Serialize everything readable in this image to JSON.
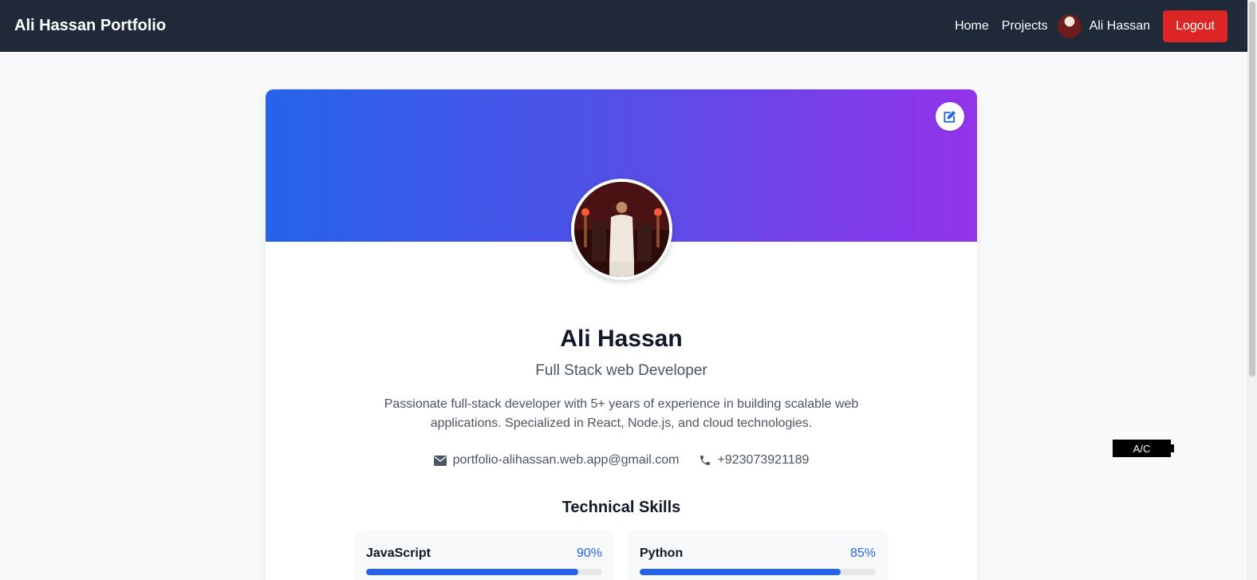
{
  "navbar": {
    "brand": "Ali Hassan Portfolio",
    "links": [
      "Home",
      "Projects"
    ],
    "user_name": "Ali Hassan",
    "logout_label": "Logout"
  },
  "profile": {
    "name": "Ali Hassan",
    "title": "Full Stack web Developer",
    "bio": "Passionate full-stack developer with 5+ years of experience in building scalable web applications. Specialized in React, Node.js, and cloud technologies.",
    "email": "portfolio-alihassan.web.app@gmail.com",
    "phone": "+923073921189",
    "banner_gradient": [
      "#2563eb",
      "#9333ea"
    ]
  },
  "skills": {
    "heading": "Technical Skills",
    "items": [
      {
        "name": "JavaScript",
        "percent_label": "90%",
        "level": 0.9
      },
      {
        "name": "Python",
        "percent_label": "85%",
        "level": 0.85
      }
    ]
  },
  "badge": {
    "label": "A/C"
  },
  "colors": {
    "navbar_bg": "#1f2937",
    "logout_bg": "#dc2626",
    "accent": "#2563eb"
  },
  "icons": [
    "edit-icon",
    "envelope-icon",
    "phone-icon"
  ]
}
